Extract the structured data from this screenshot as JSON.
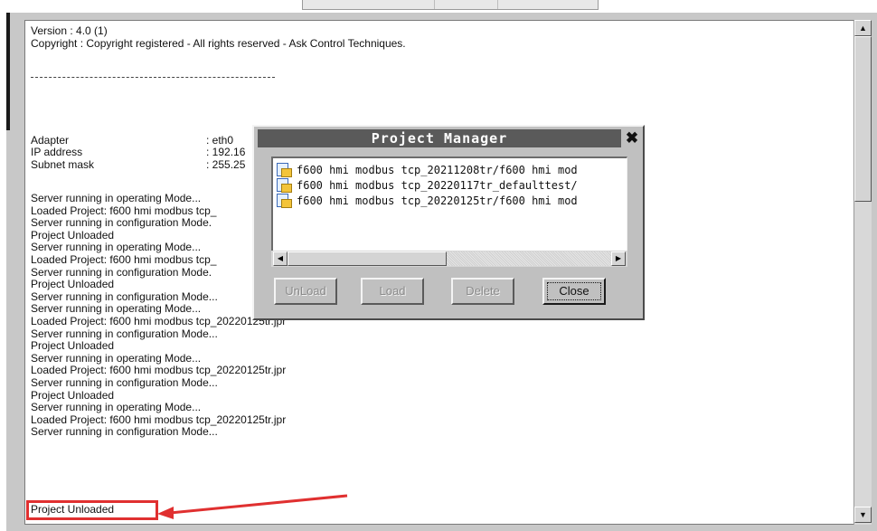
{
  "log": {
    "header": [
      "Version : 4.0 (1)",
      "Copyright : Copyright registered - All rights reserved - Ask Control Techniques."
    ],
    "network": [
      {
        "label": "Adapter",
        "value": ": eth0"
      },
      {
        "label": "IP address",
        "value": ": 192.16"
      },
      {
        "label": "Subnet mask",
        "value": ": 255.25"
      }
    ],
    "lines": [
      "Server running in operating Mode...",
      "Loaded Project: f600 hmi modbus tcp_",
      "Server running in configuration Mode.",
      "Project Unloaded",
      "Server running in operating Mode...",
      "Loaded Project: f600 hmi modbus tcp_",
      "Server running in configuration Mode.",
      "Project Unloaded",
      "Server running in configuration Mode...",
      "Server running in operating Mode...",
      "Loaded Project: f600 hmi modbus tcp_20220125tr.jpr",
      "Server running in configuration Mode...",
      "Project Unloaded",
      "Server running in operating Mode...",
      "Loaded Project: f600 hmi modbus tcp_20220125tr.jpr",
      "Server running in configuration Mode...",
      "Project Unloaded",
      "Server running in operating Mode...",
      "Loaded Project: f600 hmi modbus tcp_20220125tr.jpr",
      "Server running in configuration Mode...",
      "Project Unloaded"
    ]
  },
  "dialog": {
    "title": "Project Manager",
    "close_glyph": "✖",
    "projects": [
      "f600 hmi modbus tcp_20211208tr/f600 hmi mod",
      "f600 hmi modbus tcp_20220117tr_defaulttest/",
      "f600 hmi modbus tcp_20220125tr/f600 hmi mod"
    ],
    "buttons": {
      "unload": "UnLoad",
      "load": "Load",
      "delete": "Delete",
      "close": "Close"
    }
  },
  "scroll": {
    "up": "▲",
    "down": "▼",
    "left": "◀",
    "right": "▶"
  },
  "colors": {
    "highlight": "#e03030",
    "titlebar": "#5a5a5a"
  }
}
